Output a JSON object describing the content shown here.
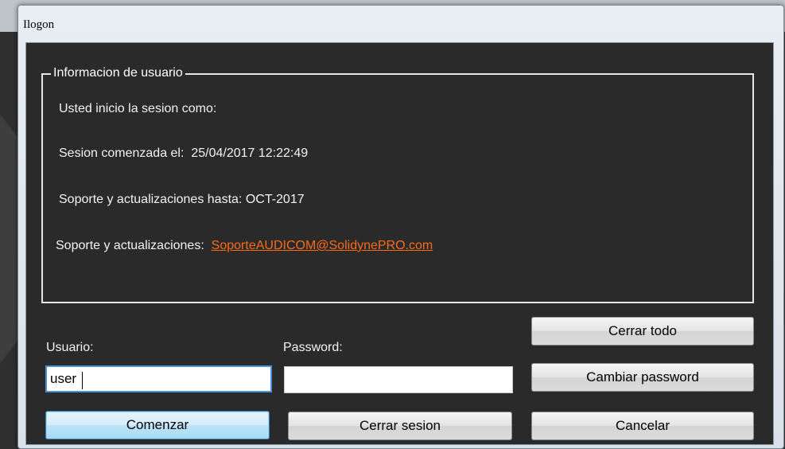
{
  "window": {
    "title": "Ilogon"
  },
  "info_group": {
    "legend": "Informacion de usuario",
    "logged_in_label": "Usted inicio la sesion como:",
    "session_started_label": "Sesion comenzada el:",
    "session_started_value": "25/04/2017 12:22:49",
    "support_until_label": "Soporte y actualizaciones hasta:",
    "support_until_value": "OCT-2017",
    "support_contact_label": "Soporte y actualizaciones:",
    "support_contact_email": "SoporteAUDICOM@SolidynePRO.com"
  },
  "form": {
    "user_label": "Usuario:",
    "user_value": "user",
    "password_label": "Password:",
    "password_value": ""
  },
  "buttons": {
    "close_all": "Cerrar todo",
    "change_password": "Cambiar password",
    "start": "Comenzar",
    "logout": "Cerrar sesion",
    "cancel": "Cancelar"
  },
  "colors": {
    "panel_background": "#2a2a2a",
    "link": "#ff6a14",
    "focus_border": "#4a90d9"
  }
}
